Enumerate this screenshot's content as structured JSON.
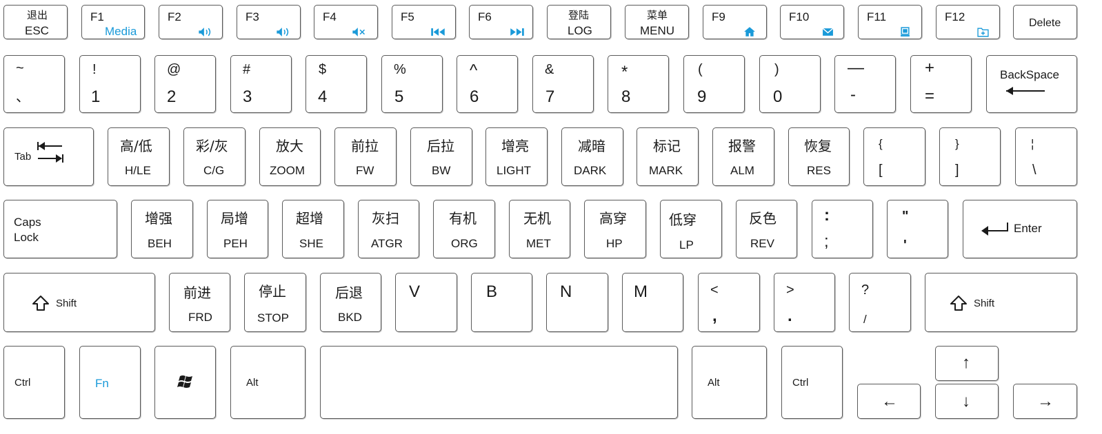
{
  "row1": {
    "esc": {
      "cn": "退出",
      "en": "ESC"
    },
    "f1": {
      "label": "F1",
      "sub": "Media"
    },
    "f2": {
      "label": "F2",
      "icon": "volume-down-icon"
    },
    "f3": {
      "label": "F3",
      "icon": "volume-up-icon"
    },
    "f4": {
      "label": "F4",
      "icon": "mute-icon"
    },
    "f5": {
      "label": "F5",
      "icon": "previous-track-icon"
    },
    "f6": {
      "label": "F6",
      "icon": "next-track-icon"
    },
    "log": {
      "cn": "登陆",
      "en": "LOG"
    },
    "menu": {
      "cn": "菜单",
      "en": "MENU"
    },
    "f9": {
      "label": "F9",
      "icon": "home-icon"
    },
    "f10": {
      "label": "F10",
      "icon": "mail-icon"
    },
    "f11": {
      "label": "F11",
      "icon": "computer-icon"
    },
    "f12": {
      "label": "F12",
      "icon": "folder-icon"
    },
    "delete": {
      "label": "Delete"
    }
  },
  "row2": {
    "keys": [
      {
        "top": "~",
        "bottom": "、"
      },
      {
        "top": "!",
        "bottom": "1"
      },
      {
        "top": "@",
        "bottom": "2"
      },
      {
        "top": "#",
        "bottom": "3"
      },
      {
        "top": "$",
        "bottom": "4"
      },
      {
        "top": "%",
        "bottom": "5"
      },
      {
        "top": "^",
        "bottom": "6"
      },
      {
        "top": "&",
        "bottom": "7"
      },
      {
        "top": "*",
        "bottom": "8"
      },
      {
        "top": "(",
        "bottom": "9"
      },
      {
        "top": ")",
        "bottom": "0"
      },
      {
        "top": "—",
        "bottom": "-"
      },
      {
        "top": "+",
        "bottom": "="
      }
    ],
    "backspace": {
      "label": "BackSpace",
      "icon": "backspace-arrow-icon"
    }
  },
  "row3": {
    "tab": {
      "label": "Tab",
      "icon": "tab-arrows-icon"
    },
    "keys": [
      {
        "cn": "高/低",
        "en": "H/LE"
      },
      {
        "cn": "彩/灰",
        "en": "C/G"
      },
      {
        "cn": "放大",
        "en": "ZOOM"
      },
      {
        "cn": "前拉",
        "en": "FW"
      },
      {
        "cn": "后拉",
        "en": "BW"
      },
      {
        "cn": "增亮",
        "en": "LIGHT"
      },
      {
        "cn": "减暗",
        "en": "DARK"
      },
      {
        "cn": "标记",
        "en": "MARK"
      },
      {
        "cn": "报警",
        "en": "ALM"
      },
      {
        "cn": "恢复",
        "en": "RES"
      }
    ],
    "brackets": [
      {
        "top": "{",
        "bottom": "["
      },
      {
        "top": "}",
        "bottom": "]"
      },
      {
        "top": "¦",
        "bottom": "\\"
      }
    ]
  },
  "row4": {
    "caps": {
      "line1": "Caps",
      "line2": "Lock"
    },
    "keys": [
      {
        "cn": "增强",
        "en": "BEH"
      },
      {
        "cn": "局增",
        "en": "PEH"
      },
      {
        "cn": "超增",
        "en": "SHE"
      },
      {
        "cn": "灰扫",
        "en": "ATGR"
      },
      {
        "cn": "有机",
        "en": "ORG"
      },
      {
        "cn": "无机",
        "en": "MET"
      },
      {
        "cn": "高穿",
        "en": "HP"
      },
      {
        "cn": "低穿",
        "en": "LP"
      },
      {
        "cn": "反色",
        "en": "REV"
      }
    ],
    "punct": [
      {
        "top": ":",
        "bottom": ";"
      },
      {
        "top": "\"",
        "bottom": "'"
      }
    ],
    "enter": {
      "label": "Enter",
      "icon": "enter-arrow-icon"
    }
  },
  "row5": {
    "shift_left": {
      "label": "Shift",
      "icon": "shift-icon"
    },
    "keys": [
      {
        "cn": "前进",
        "en": "FRD"
      },
      {
        "cn": "停止",
        "en": "STOP"
      },
      {
        "cn": "后退",
        "en": "BKD"
      }
    ],
    "letters": [
      "V",
      "B",
      "N",
      "M"
    ],
    "punct": [
      {
        "top": "<",
        "bottom": ","
      },
      {
        "top": ">",
        "bottom": "."
      },
      {
        "top": "?",
        "bottom": "/"
      }
    ],
    "shift_right": {
      "label": "Shift",
      "icon": "shift-icon"
    }
  },
  "row6": {
    "ctrl_left": "Ctrl",
    "fn": "Fn",
    "windows_icon": "windows-logo-icon",
    "alt_left": "Alt",
    "alt_right": "Alt",
    "ctrl_right": "Ctrl",
    "arrows": {
      "up": "↑",
      "down": "↓",
      "left": "←",
      "right": "→"
    }
  },
  "colors": {
    "accent": "#1a9ad9",
    "border": "#5a5a5a",
    "text": "#1a1a1a"
  }
}
